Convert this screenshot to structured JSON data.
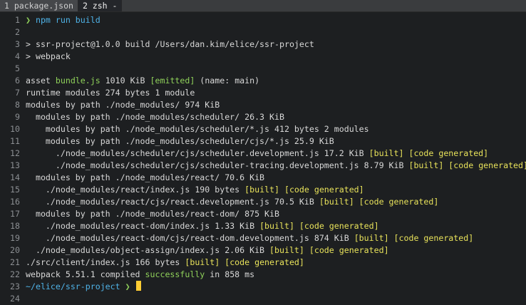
{
  "tabs": [
    {
      "label": "1 package.json"
    },
    {
      "label": "2 zsh -"
    }
  ],
  "lines": [
    {
      "n": "1",
      "parts": [
        {
          "t": "❯ ",
          "c": "green"
        },
        {
          "t": "npm run build",
          "c": "blue"
        }
      ]
    },
    {
      "n": "2",
      "parts": []
    },
    {
      "n": "3",
      "parts": [
        {
          "t": "> ssr-project@1.0.0 build /Users/dan.kim/elice/ssr-project",
          "c": ""
        }
      ]
    },
    {
      "n": "4",
      "parts": [
        {
          "t": "> webpack",
          "c": ""
        }
      ]
    },
    {
      "n": "5",
      "parts": []
    },
    {
      "n": "6",
      "parts": [
        {
          "t": "asset ",
          "c": ""
        },
        {
          "t": "bundle.js",
          "c": "green"
        },
        {
          "t": " 1010 KiB ",
          "c": ""
        },
        {
          "t": "[emitted]",
          "c": "green"
        },
        {
          "t": " (name: main)",
          "c": ""
        }
      ]
    },
    {
      "n": "7",
      "parts": [
        {
          "t": "runtime modules 274 bytes 1 module",
          "c": ""
        }
      ]
    },
    {
      "n": "8",
      "parts": [
        {
          "t": "modules by path ./node_modules/ 974 KiB",
          "c": ""
        }
      ]
    },
    {
      "n": "9",
      "parts": [
        {
          "t": "  modules by path ./node_modules/scheduler/ 26.3 KiB",
          "c": ""
        }
      ]
    },
    {
      "n": "10",
      "parts": [
        {
          "t": "    modules by path ./node_modules/scheduler/*.js 412 bytes 2 modules",
          "c": ""
        }
      ]
    },
    {
      "n": "11",
      "parts": [
        {
          "t": "    modules by path ./node_modules/scheduler/cjs/*.js 25.9 KiB",
          "c": ""
        }
      ]
    },
    {
      "n": "12",
      "parts": [
        {
          "t": "      ./node_modules/scheduler/cjs/scheduler.development.js 17.2 KiB ",
          "c": ""
        },
        {
          "t": "[built] [code generated]",
          "c": "yellow"
        }
      ]
    },
    {
      "n": "13",
      "parts": [
        {
          "t": "      ./node_modules/scheduler/cjs/scheduler-tracing.development.js 8.79 KiB ",
          "c": ""
        },
        {
          "t": "[built] [code generated]",
          "c": "yellow"
        }
      ]
    },
    {
      "n": "14",
      "parts": [
        {
          "t": "  modules by path ./node_modules/react/ 70.6 KiB",
          "c": ""
        }
      ]
    },
    {
      "n": "15",
      "parts": [
        {
          "t": "    ./node_modules/react/index.js 190 bytes ",
          "c": ""
        },
        {
          "t": "[built] [code generated]",
          "c": "yellow"
        }
      ]
    },
    {
      "n": "16",
      "parts": [
        {
          "t": "    ./node_modules/react/cjs/react.development.js 70.5 KiB ",
          "c": ""
        },
        {
          "t": "[built] [code generated]",
          "c": "yellow"
        }
      ]
    },
    {
      "n": "17",
      "parts": [
        {
          "t": "  modules by path ./node_modules/react-dom/ 875 KiB",
          "c": ""
        }
      ]
    },
    {
      "n": "18",
      "parts": [
        {
          "t": "    ./node_modules/react-dom/index.js 1.33 KiB ",
          "c": ""
        },
        {
          "t": "[built] [code generated]",
          "c": "yellow"
        }
      ]
    },
    {
      "n": "19",
      "parts": [
        {
          "t": "    ./node_modules/react-dom/cjs/react-dom.development.js 874 KiB ",
          "c": ""
        },
        {
          "t": "[built] [code generated]",
          "c": "yellow"
        }
      ]
    },
    {
      "n": "20",
      "parts": [
        {
          "t": "  ./node_modules/object-assign/index.js 2.06 KiB ",
          "c": ""
        },
        {
          "t": "[built] [code generated]",
          "c": "yellow"
        }
      ]
    },
    {
      "n": "21",
      "parts": [
        {
          "t": "./src/client/index.js 166 bytes ",
          "c": ""
        },
        {
          "t": "[built] [code generated]",
          "c": "yellow"
        }
      ]
    },
    {
      "n": "22",
      "parts": [
        {
          "t": "webpack 5.51.1 compiled ",
          "c": ""
        },
        {
          "t": "successfully",
          "c": "green"
        },
        {
          "t": " in 858 ms",
          "c": ""
        }
      ]
    },
    {
      "n": "23",
      "parts": [
        {
          "t": "~/elice/ssr-project",
          "c": "blue"
        },
        {
          "t": " ❯ ",
          "c": "green"
        }
      ],
      "cursor": true
    },
    {
      "n": "24",
      "parts": []
    }
  ],
  "colors": {
    "green": "#8fd15a",
    "yellow": "#e8e25a",
    "blue": "#4fb3e8",
    "cursor": "#ffcc33"
  }
}
